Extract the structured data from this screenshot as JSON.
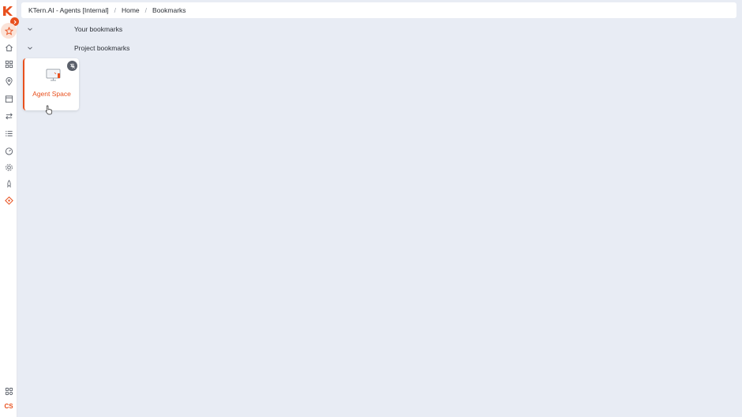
{
  "breadcrumb": {
    "workspace": "KTern.AI - Agents [Internal]",
    "separator": "/",
    "home": "Home",
    "current": "Bookmarks"
  },
  "sections": {
    "your_bookmarks": {
      "label": "Your bookmarks",
      "expanded": false
    },
    "project_bookmarks": {
      "label": "Project bookmarks",
      "expanded": true
    }
  },
  "bookmarks": [
    {
      "name": "Agent Space",
      "icon": "monitor-icon",
      "action_icon": "unpin-icon"
    }
  ],
  "sidebar": {
    "items": [
      {
        "icon": "star-icon",
        "active": true
      },
      {
        "icon": "home-icon"
      },
      {
        "icon": "grid-icon"
      },
      {
        "icon": "location-pin-icon"
      },
      {
        "icon": "calendar-icon"
      },
      {
        "icon": "transfer-arrows-icon"
      },
      {
        "icon": "list-icon"
      },
      {
        "icon": "dashboard-gauge-icon"
      },
      {
        "icon": "settings-gear-icon"
      },
      {
        "icon": "rocket-icon"
      },
      {
        "icon": "agent-diamond-icon",
        "accent": true
      }
    ],
    "bottom": {
      "icon": "apps-icon",
      "user_initials": "CS"
    }
  },
  "colors": {
    "accent": "#e8501e",
    "background": "#e8ecf4",
    "surface": "#ffffff",
    "icon_gray": "#5b606a"
  }
}
